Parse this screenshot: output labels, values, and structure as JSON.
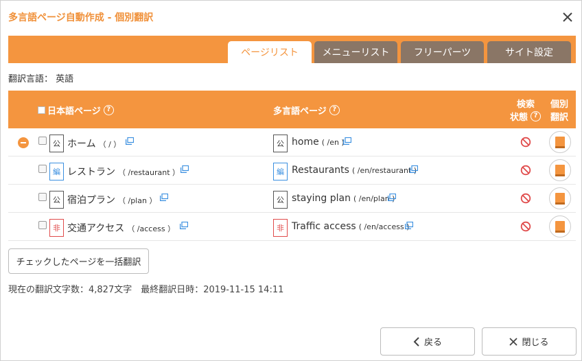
{
  "dialog": {
    "title": "多言語ページ自動作成 - 個別翻訳"
  },
  "tabs": [
    {
      "label": "ページリスト",
      "active": true
    },
    {
      "label": "メニューリスト",
      "active": false
    },
    {
      "label": "フリーパーツ",
      "active": false
    },
    {
      "label": "サイト設定",
      "active": false
    }
  ],
  "language_line": "翻訳言語： 英語",
  "table": {
    "headers": {
      "japanese_page": "日本語ページ",
      "multilang_page": "多言語ページ",
      "index_status_1": "検索",
      "index_status_2": "状態",
      "individual_1": "個別",
      "individual_2": "翻訳"
    },
    "rows": [
      {
        "status": "公",
        "jp_title": "ホーム",
        "jp_path": "（ / ）",
        "ml_status": "公",
        "ml_title": "home",
        "ml_path": "( /en )"
      },
      {
        "status": "編",
        "jp_title": "レストラン",
        "jp_path": "（ /restaurant ）",
        "ml_status": "編",
        "ml_title": "Restaurants",
        "ml_path": "( /en/restaurant )"
      },
      {
        "status": "公",
        "jp_title": "宿泊プラン",
        "jp_path": "（ /plan ）",
        "ml_status": "公",
        "ml_title": "staying plan",
        "ml_path": "( /en/plan )"
      },
      {
        "status": "非",
        "jp_title": "交通アクセス",
        "jp_path": "（ /access ）",
        "ml_status": "非",
        "ml_title": "Traffic access",
        "ml_path": "( /en/access )"
      }
    ]
  },
  "bulk_button": "チェックしたページを一括翻訳",
  "stats": "現在の翻訳文字数：4,827文字　最終翻訳日時：2019-11-15 14:11",
  "footer": {
    "back": "戻る",
    "close": "閉じる"
  },
  "colors": {
    "accent": "#f4953f",
    "inactive_tab": "#8a7666",
    "title": "#f0913a"
  }
}
